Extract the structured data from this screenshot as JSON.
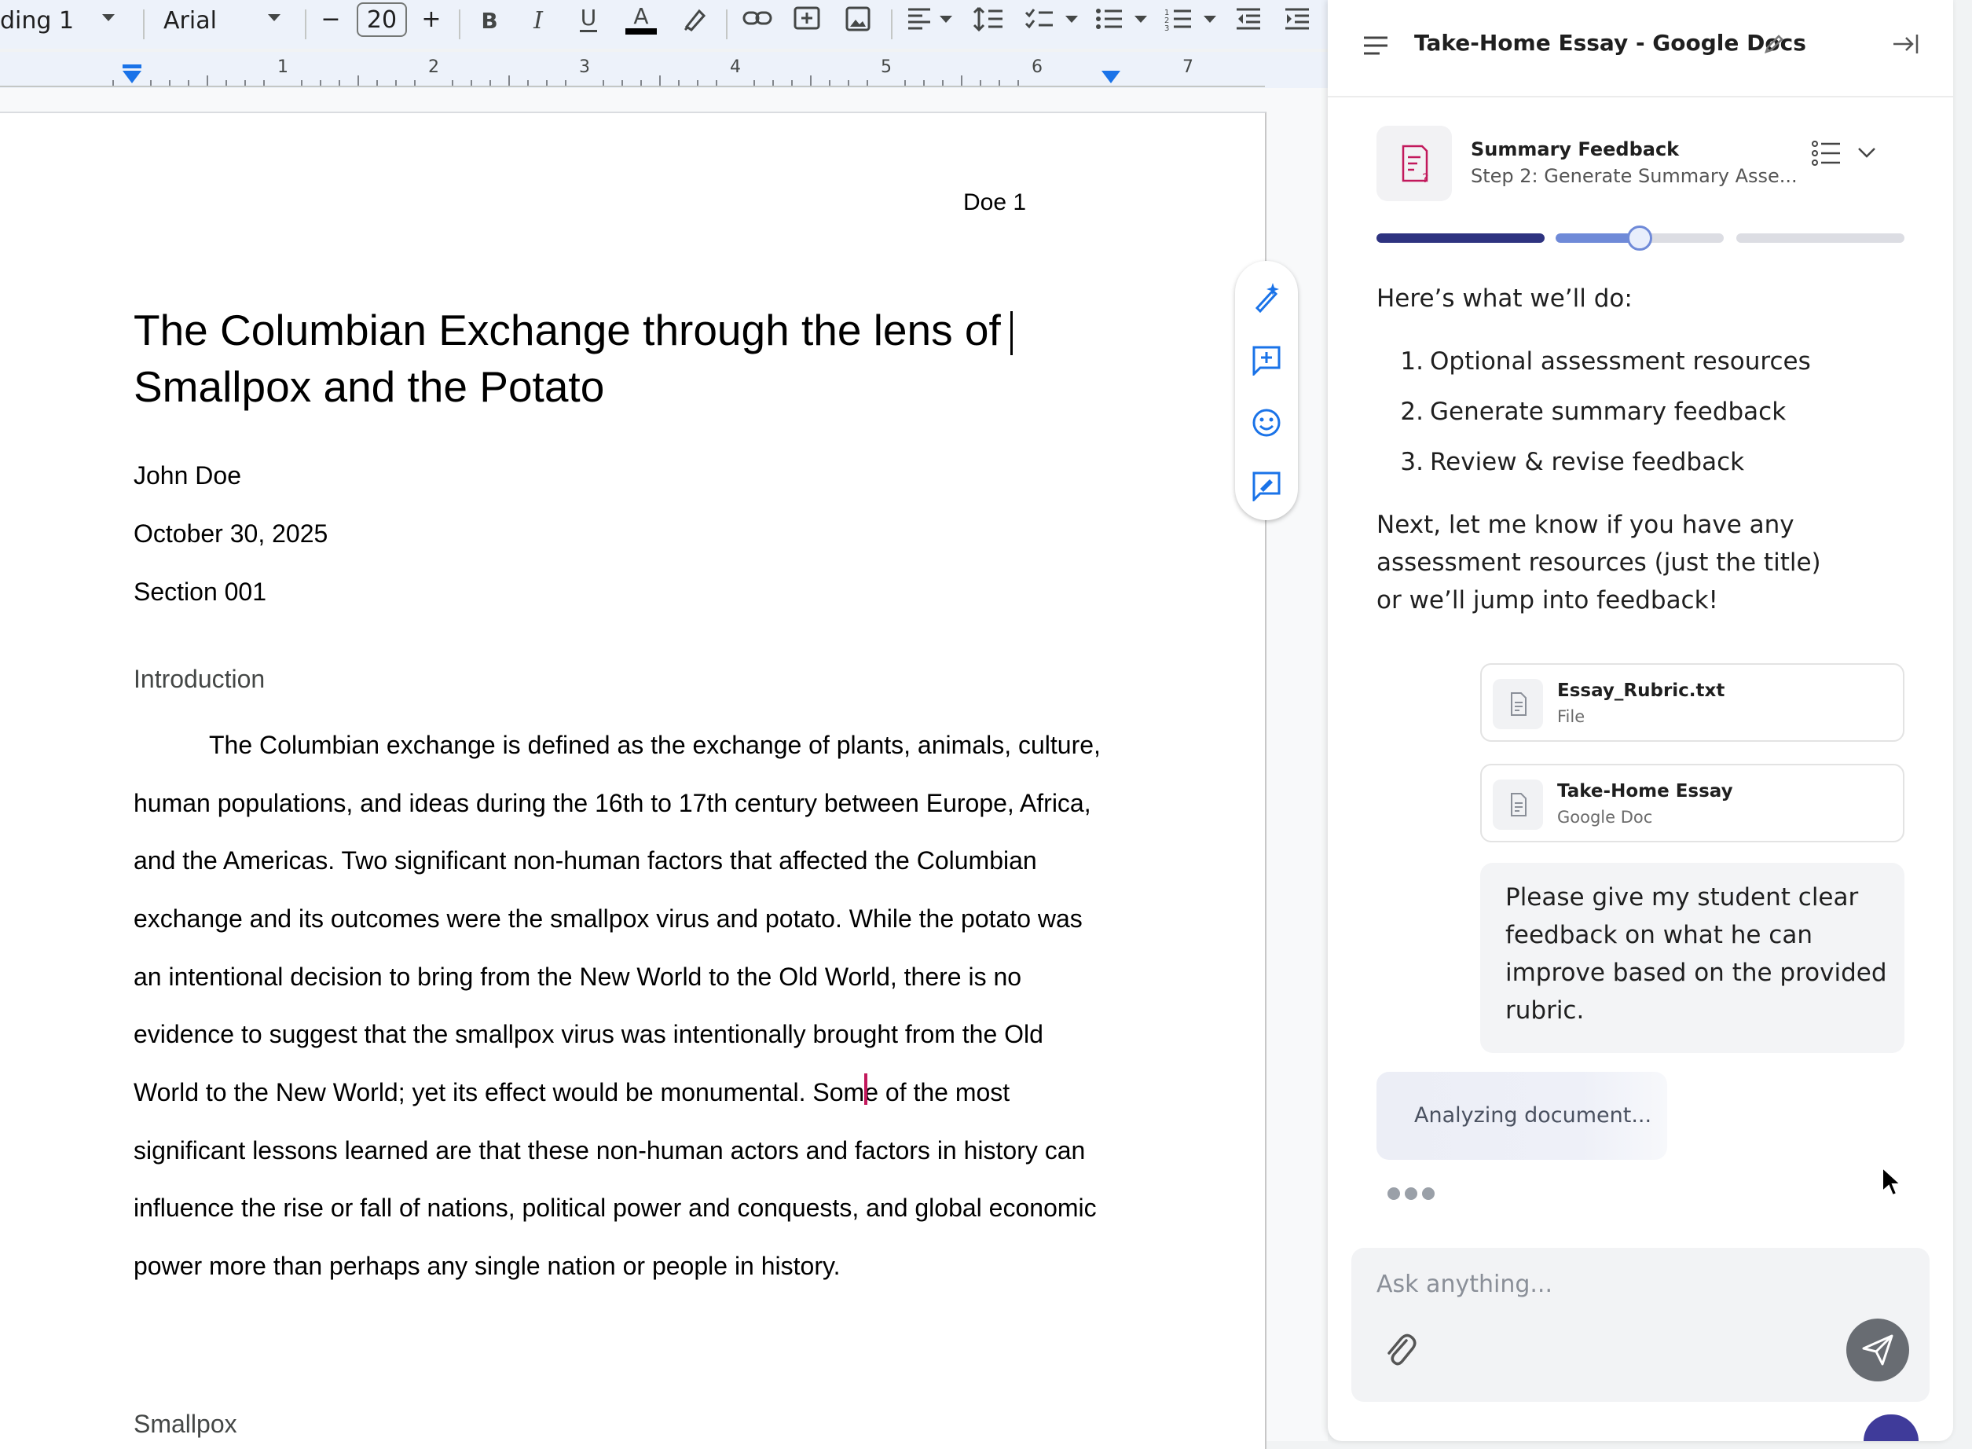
{
  "toolbar": {
    "style_label": "ding 1",
    "font_label": "Arial",
    "font_size": "20",
    "minus_label": "−",
    "plus_label": "+"
  },
  "ruler": {
    "numbers": [
      "1",
      "2",
      "3",
      "4",
      "5",
      "6",
      "7"
    ]
  },
  "document": {
    "header": "Doe 1",
    "title_line1": "The Columbian Exchange through the lens of",
    "title_line2": "Smallpox and the Potato",
    "author": "John Doe",
    "date": "October 30, 2025",
    "section": "Section 001",
    "heading_intro": "Introduction",
    "paragraph_lines": [
      "The Columbian exchange is defined as the exchange of plants, animals, culture,",
      "human populations, and ideas during the 16th to 17th century between Europe, Africa,",
      "and the Americas. Two significant non-human factors that affected the Columbian",
      "exchange and its outcomes were the smallpox virus and potato. While the potato was",
      "an intentional decision to bring from the New World to the Old World, there is no",
      "evidence to suggest that the smallpox virus was intentionally brought from the Old",
      "World to the New World; yet its effect would be monumental. Some of the most",
      "significant lessons learned are that these non-human actors and factors in history can",
      "influence the rise or fall of nations, political power and conquests, and global economic",
      "power more than perhaps any single nation or people in history."
    ],
    "heading_smallpox": "Smallpox"
  },
  "panel": {
    "doc_title": "Take-Home Essay - Google Docs",
    "step_title": "Summary Feedback",
    "step_subtitle": "Step 2: Generate Summary Asse...",
    "step_progress": 0.5,
    "intro": "Here’s what we’ll do:",
    "plan": [
      {
        "num": "1.",
        "text": "Optional assessment resources"
      },
      {
        "num": "2.",
        "text": "Generate summary feedback"
      },
      {
        "num": "3.",
        "text": "Review & revise feedback"
      }
    ],
    "message_lines": [
      "Next, let me know if you have any",
      "assessment resources (just the title)",
      "or we’ll jump into feedback!"
    ],
    "files": [
      {
        "name": "Essay_Rubric.txt",
        "type": "File"
      },
      {
        "name": "Take-Home Essay",
        "type": "Google Doc"
      }
    ],
    "user_message_lines": [
      "Please give my student clear",
      "feedback on what he can",
      "improve based on the provided",
      "rubric."
    ],
    "status": "Analyzing document...",
    "input_placeholder": "Ask anything..."
  },
  "colors": {
    "accent_dark": "#2e3380",
    "accent_light": "#6f8ad8",
    "track": "#dcdde3",
    "doc_icon": "#c2185b"
  }
}
